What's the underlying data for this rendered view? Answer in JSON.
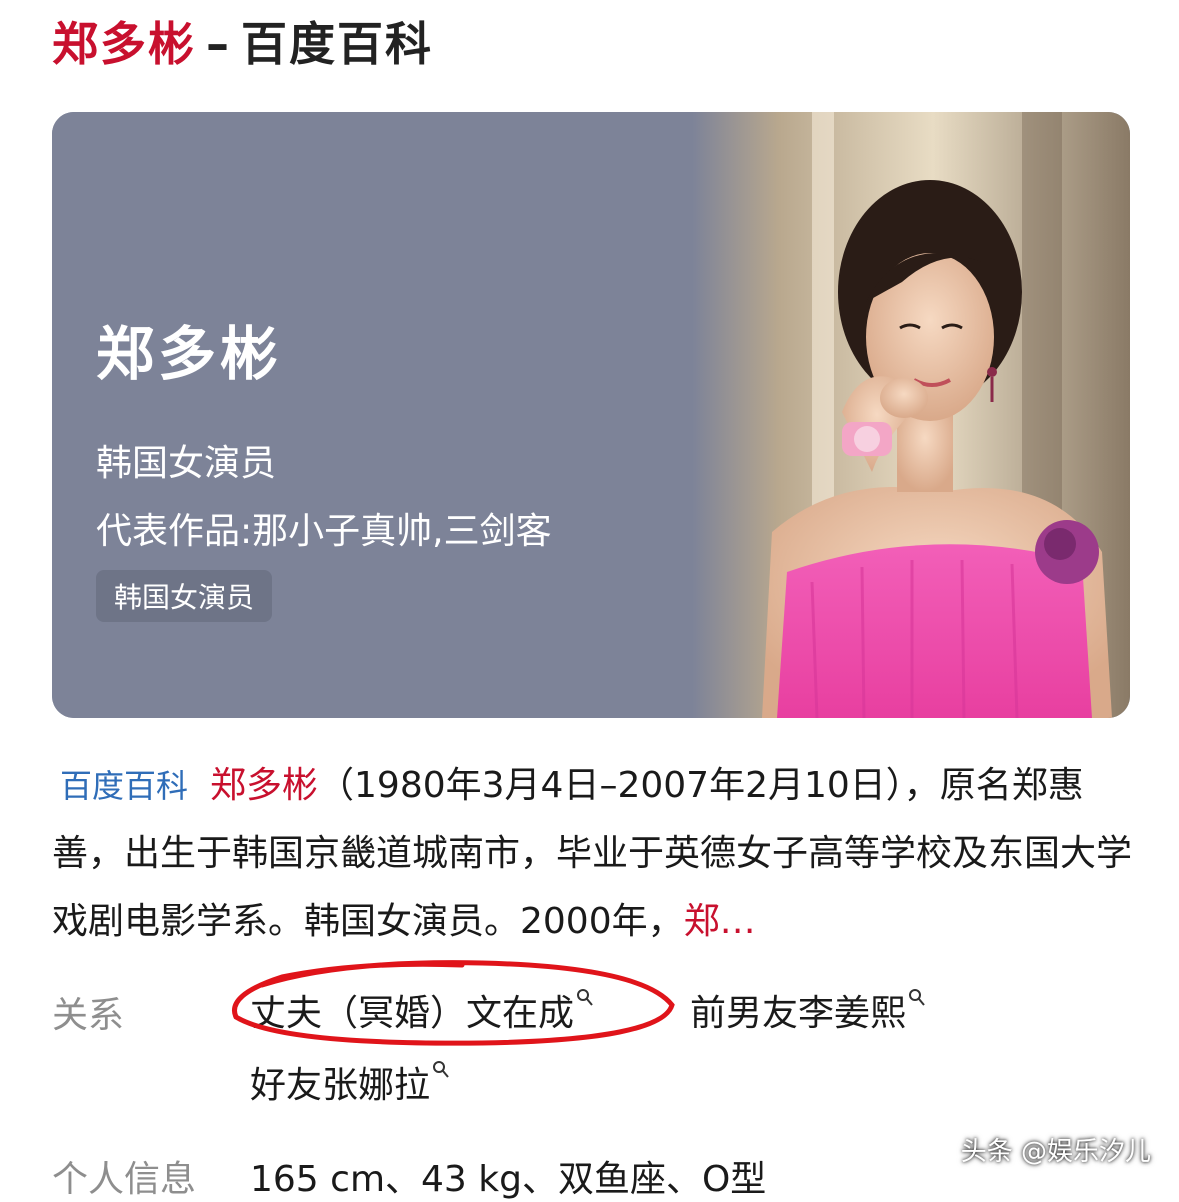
{
  "header": {
    "name": "郑多彬",
    "separator": "–",
    "site": "百度百科"
  },
  "hero": {
    "name": "郑多彬",
    "subtitle": "韩国女演员",
    "works": "代表作品:那小子真帅,三剑客",
    "tag": "韩国女演员"
  },
  "summary": {
    "source": "百度百科",
    "name": "郑多彬",
    "text": "（1980年3月4日–2007年2月10日），原名郑惠善，出生于韩国京畿道城南市，毕业于英德女子高等学校及东国大学戏剧电影学系。韩国女演员。2000年，",
    "trail": "郑…"
  },
  "relations": {
    "label": "关系",
    "items": [
      "丈夫（冥婚）文在成",
      "前男友李姜熙",
      "好友张娜拉"
    ]
  },
  "info": {
    "label": "个人信息",
    "value": "165 cm、43 kg、双鱼座、O型"
  },
  "watermark": "头条 @娱乐汐儿",
  "colors": {
    "brand_red": "#c8102e",
    "link_blue": "#2f6db8",
    "hero_panel": "#7d8398",
    "annotation_red": "#e0141a"
  }
}
